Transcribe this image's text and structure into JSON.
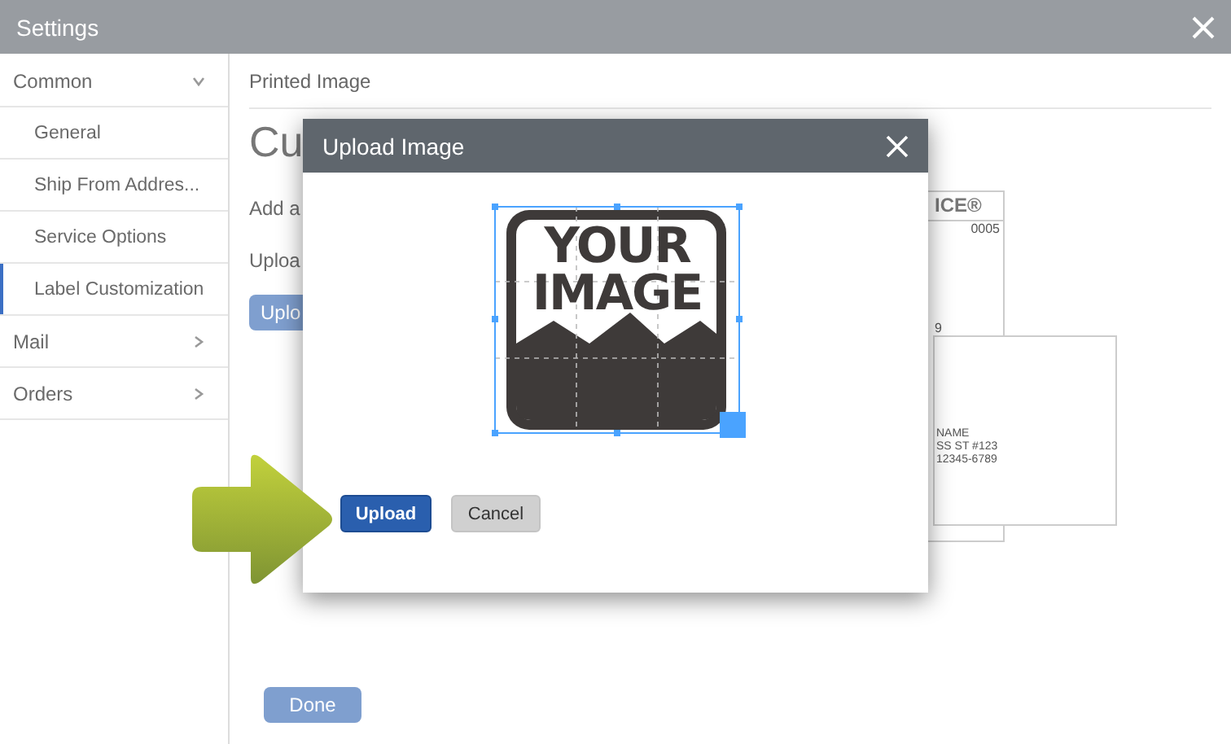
{
  "window": {
    "title": "Settings"
  },
  "sidebar": {
    "items": [
      {
        "label": "Common",
        "expanded": true,
        "selected": false,
        "children": [
          {
            "label": "General",
            "selected": false
          },
          {
            "label": "Ship From Addres...",
            "selected": false
          },
          {
            "label": "Service Options",
            "selected": false
          },
          {
            "label": "Label Customization",
            "selected": true
          }
        ]
      },
      {
        "label": "Mail",
        "expanded": false,
        "selected": false
      },
      {
        "label": "Orders",
        "expanded": false,
        "selected": false
      }
    ]
  },
  "content": {
    "section": "Printed Image",
    "heading": "Cu",
    "lines": [
      "Add a",
      "Uploa"
    ],
    "upload_button": "Uplo",
    "done_button": "Done",
    "label_preview": {
      "header": "ICE®",
      "number": "0005",
      "fragment": "9",
      "address": [
        "NAME",
        "SS ST #123",
        "12345-6789"
      ]
    }
  },
  "dialog": {
    "title": "Upload Image",
    "preview_text": [
      "YOUR",
      "IMAGE"
    ],
    "buttons": [
      {
        "label": "Upload",
        "kind": "primary"
      },
      {
        "label": "Cancel",
        "kind": "secondary"
      }
    ]
  }
}
